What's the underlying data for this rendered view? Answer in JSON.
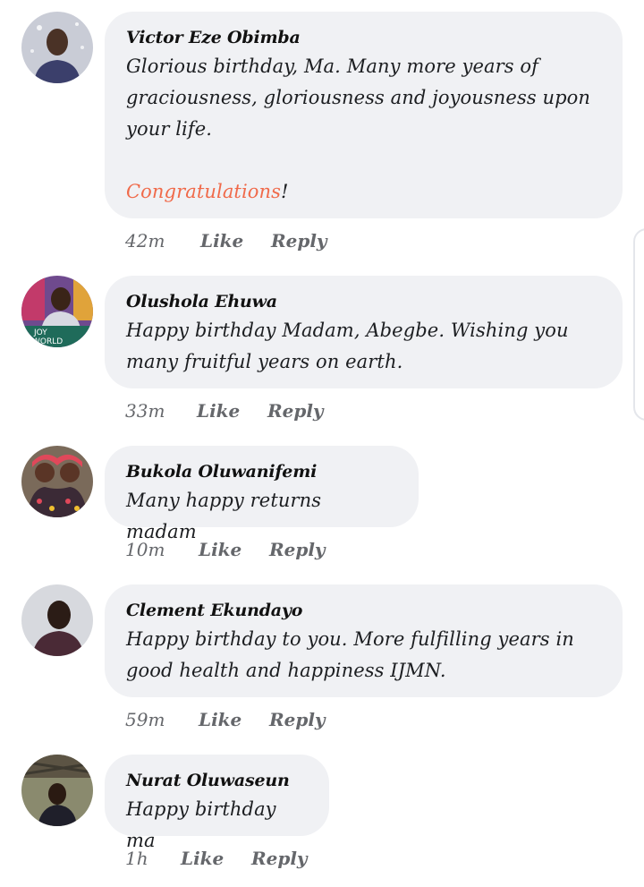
{
  "comments": [
    {
      "author": "Victor Eze Obimba",
      "text": "Glorious birthday, Ma. Many more years of graciousness, gloriousness and joyousness upon your life.",
      "text_extra": "Congratulations",
      "text_extra_suffix": "!",
      "time": "42m",
      "like_label": "Like",
      "reply_label": "Reply"
    },
    {
      "author": "Olushola Ehuwa",
      "text": "Happy birthday Madam, Abegbe. Wishing you many fruitful years on earth.",
      "time": "33m",
      "like_label": "Like",
      "reply_label": "Reply",
      "avatar_caption_1": "JOY",
      "avatar_caption_2": "WORLD"
    },
    {
      "author": "Bukola Oluwanifemi",
      "text": "Many happy returns madam",
      "time": "10m",
      "like_label": "Like",
      "reply_label": "Reply"
    },
    {
      "author": "Clement Ekundayo",
      "text": "Happy birthday to you. More fulfilling years in good health and happiness IJMN.",
      "time": "59m",
      "like_label": "Like",
      "reply_label": "Reply"
    },
    {
      "author": "Nurat Oluwaseun",
      "text": "Happy birthday ma",
      "time": "1h",
      "like_label": "Like",
      "reply_label": "Reply"
    }
  ],
  "colors": {
    "bubble_bg": "#f0f1f4",
    "meta_text": "#65676b",
    "highlight": "#f06a4a"
  }
}
